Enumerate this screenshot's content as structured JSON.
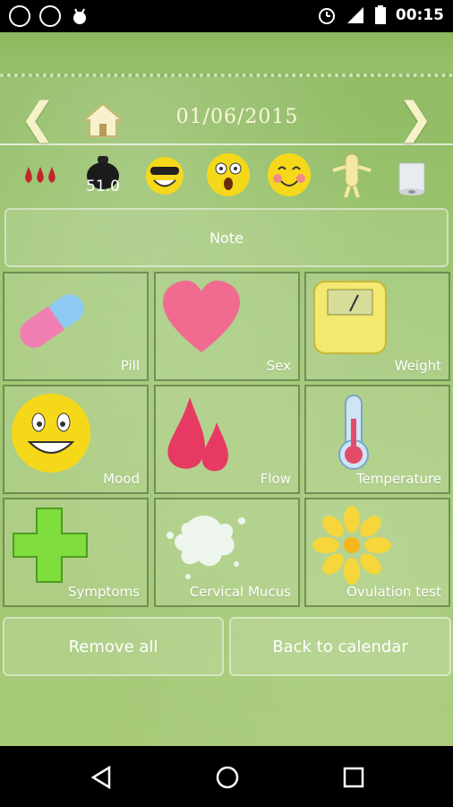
{
  "status_bar": {
    "time": "00:15",
    "left_icons": [
      "cc-icon",
      "sync-icon",
      "android-icon"
    ],
    "right_icons": [
      "alarm-icon",
      "signal-icon",
      "battery-icon"
    ]
  },
  "header": {
    "date": "01/06/2015",
    "prev_icon": "chevron-left-icon",
    "next_icon": "chevron-right-icon",
    "home_icon": "home-icon"
  },
  "icon_row": {
    "weight_value": "51.0",
    "items": [
      "flow-drops-icon",
      "weight-icon",
      "cool-smiley-icon",
      "surprised-smiley-icon",
      "blush-smiley-icon",
      "condom-icon",
      "toilet-paper-icon"
    ]
  },
  "note_label": "Note",
  "tiles": [
    {
      "label": "Pill",
      "icon": "pill-icon"
    },
    {
      "label": "Sex",
      "icon": "heart-icon"
    },
    {
      "label": "Weight",
      "icon": "scale-icon"
    },
    {
      "label": "Mood",
      "icon": "smiley-icon"
    },
    {
      "label": "Flow",
      "icon": "drops-icon"
    },
    {
      "label": "Temperature",
      "icon": "thermometer-icon"
    },
    {
      "label": "Symptoms",
      "icon": "plus-icon"
    },
    {
      "label": "Cervical Mucus",
      "icon": "splash-icon"
    },
    {
      "label": "Ovulation test",
      "icon": "flower-icon"
    }
  ],
  "buttons": {
    "remove_all": "Remove all",
    "back_to_calendar": "Back to calendar"
  },
  "colors": {
    "accent_background": "#9bc46d",
    "date_text": "#fbf7dc"
  }
}
